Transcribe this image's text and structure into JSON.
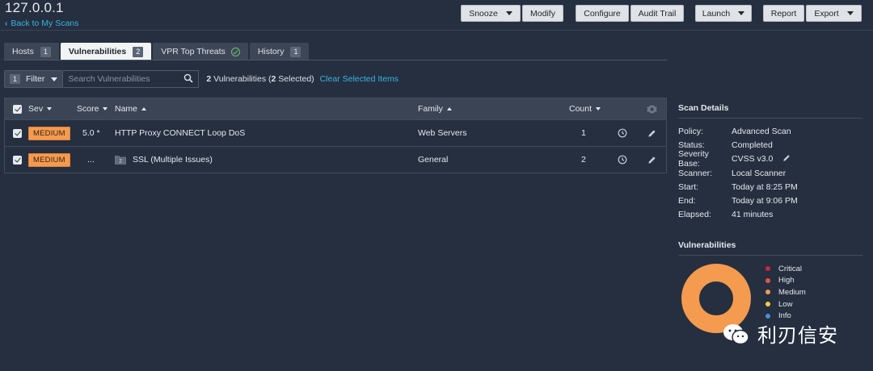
{
  "host": {
    "title": "127.0.0.1",
    "back_label": "Back to My Scans"
  },
  "toolbar": {
    "snooze": "Snooze",
    "modify": "Modify",
    "configure": "Configure",
    "audit_trail": "Audit Trail",
    "launch": "Launch",
    "report": "Report",
    "export": "Export"
  },
  "tabs": [
    {
      "label": "Hosts",
      "count": "1"
    },
    {
      "label": "Vulnerabilities",
      "count": "2"
    },
    {
      "label": "VPR Top Threats"
    },
    {
      "label": "History",
      "count": "1"
    }
  ],
  "filter": {
    "count": "1",
    "label": "Filter",
    "search_placeholder": "Search Vulnerabilities",
    "summary_count": "2",
    "summary_text": "Vulnerabilities",
    "selected_count": "2",
    "selected_text": "Selected",
    "clear_label": "Clear Selected Items"
  },
  "table": {
    "columns": {
      "sev": "Sev",
      "score": "Score",
      "name": "Name",
      "family": "Family",
      "count": "Count"
    },
    "rows": [
      {
        "sev": "MEDIUM",
        "score": "5.0 *",
        "name": "HTTP Proxy CONNECT Loop DoS",
        "family": "Web Servers",
        "count": "1",
        "group_count": ""
      },
      {
        "sev": "MEDIUM",
        "score": "...",
        "name": "SSL (Multiple Issues)",
        "family": "General",
        "count": "2",
        "group_count": "2"
      }
    ]
  },
  "scan_details": {
    "title": "Scan Details",
    "items": [
      {
        "label": "Policy:",
        "value": "Advanced Scan"
      },
      {
        "label": "Status:",
        "value": "Completed"
      },
      {
        "label": "Severity Base:",
        "value": "CVSS v3.0"
      },
      {
        "label": "Scanner:",
        "value": "Local Scanner"
      },
      {
        "label": "Start:",
        "value": "Today at 8:25 PM"
      },
      {
        "label": "End:",
        "value": "Today at 9:06 PM"
      },
      {
        "label": "Elapsed:",
        "value": "41 minutes"
      }
    ]
  },
  "vulnerabilities_panel": {
    "title": "Vulnerabilities"
  },
  "chart_data": {
    "type": "pie",
    "donut": true,
    "categories": [
      "Critical",
      "High",
      "Medium",
      "Low",
      "Info"
    ],
    "values": [
      0,
      0,
      2,
      0,
      0
    ],
    "colors": [
      "#c9273b",
      "#e8534a",
      "#f59b50",
      "#f0cf46",
      "#4a8fd6"
    ],
    "legend": "right"
  },
  "watermark": {
    "text": "利刃信安"
  },
  "colors": {
    "background": "#252f3f",
    "accent_link": "#39b4e3",
    "medium": "#f59b50"
  },
  "icons": {
    "search": "search-icon",
    "clock": "clock-icon",
    "edit": "pencil-icon",
    "settings": "gear-icon",
    "folder": "folder-icon"
  }
}
